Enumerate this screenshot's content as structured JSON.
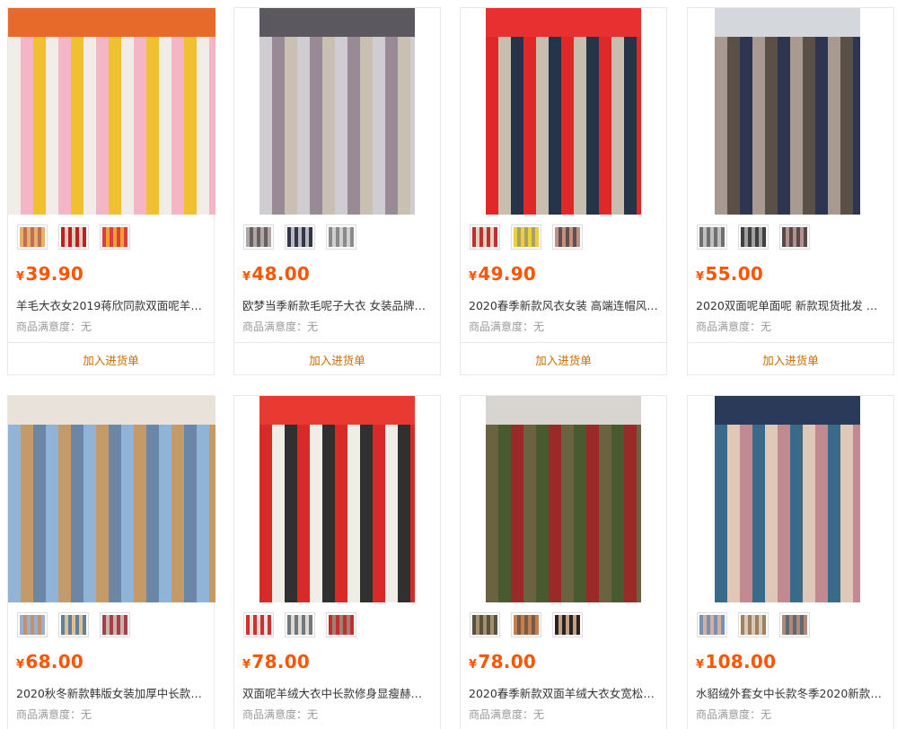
{
  "currency_symbol": "¥",
  "satisfaction_label": "商品满意度：无",
  "add_label": "加入进货单",
  "products": [
    {
      "price": "39.90",
      "title": "羊毛大衣女2019蒋欣同款双面呢羊绒…",
      "photo_colors": [
        "#f1ece8",
        "#f4b6c6",
        "#f0c030",
        "#e86a2a"
      ],
      "thumbs": [
        [
          "#e8b070",
          "#c07050"
        ],
        [
          "#c02020",
          "#e0d0c0"
        ],
        [
          "#d84040",
          "#f0a030"
        ]
      ]
    },
    {
      "price": "48.00",
      "title": "欧梦当季新款毛呢子大衣 女装品牌折…",
      "photo_colors": [
        "#d0cdd2",
        "#9a8a95",
        "#c9bfb2",
        "#5c5860"
      ],
      "thumbs": [
        [
          "#b0a8a8",
          "#6a6060"
        ],
        [
          "#303848",
          "#b8b8c0"
        ],
        [
          "#8a8a8a",
          "#d0d0d0"
        ]
      ]
    },
    {
      "price": "49.90",
      "title": "2020春季新款风衣女装 高端连帽风衣…",
      "photo_colors": [
        "#e02828",
        "#c8beb0",
        "#263448",
        "#e83030"
      ],
      "thumbs": [
        [
          "#c03030",
          "#e0d0c0"
        ],
        [
          "#e8d040",
          "#b0a060"
        ],
        [
          "#c09080",
          "#605050"
        ]
      ]
    },
    {
      "price": "55.00",
      "title": "2020双面呢单面呢 新款现货批发 秋…",
      "photo_colors": [
        "#a89a90",
        "#5a5048",
        "#2e3550",
        "#d4d8dc"
      ],
      "thumbs": [
        [
          "#707070",
          "#c0c0c0"
        ],
        [
          "#404040",
          "#a0a0a0"
        ],
        [
          "#584848",
          "#b09090"
        ]
      ]
    },
    {
      "price": "68.00",
      "title": "2020秋冬新款韩版女装加厚中长款毛…",
      "photo_colors": [
        "#8fb4d8",
        "#c49a68",
        "#6c86a8",
        "#e8e2da"
      ],
      "thumbs": [
        [
          "#9ab0c8",
          "#c09070"
        ],
        [
          "#6080a0",
          "#e0c090"
        ],
        [
          "#a04050",
          "#d0b0a0"
        ]
      ]
    },
    {
      "price": "78.00",
      "title": "双面呢羊绒大衣中长款修身显瘦赫本…",
      "photo_colors": [
        "#d82a28",
        "#f0ece6",
        "#303030",
        "#e83a30"
      ],
      "thumbs": [
        [
          "#d03030",
          "#f0e0d8"
        ],
        [
          "#707880",
          "#e0d8d0"
        ],
        [
          "#c03030",
          "#a08070"
        ]
      ]
    },
    {
      "price": "78.00",
      "title": "2020春季新款双面羊绒大衣女宽松款…",
      "photo_colors": [
        "#6a6240",
        "#4a5a30",
        "#9a2a28",
        "#d8d4d0"
      ],
      "thumbs": [
        [
          "#5a5040",
          "#a09070"
        ],
        [
          "#c08050",
          "#7a5a40"
        ],
        [
          "#2a2220",
          "#c0a080"
        ]
      ]
    },
    {
      "price": "108.00",
      "title": "水貂绒外套女中长款冬季2020新款韩…",
      "photo_colors": [
        "#3a6a8a",
        "#e0c8b8",
        "#c08a90",
        "#2a3a5a"
      ],
      "thumbs": [
        [
          "#7a90b0",
          "#d0b0a0"
        ],
        [
          "#a08060",
          "#d8c8b8"
        ],
        [
          "#b08878",
          "#606870"
        ]
      ]
    }
  ]
}
